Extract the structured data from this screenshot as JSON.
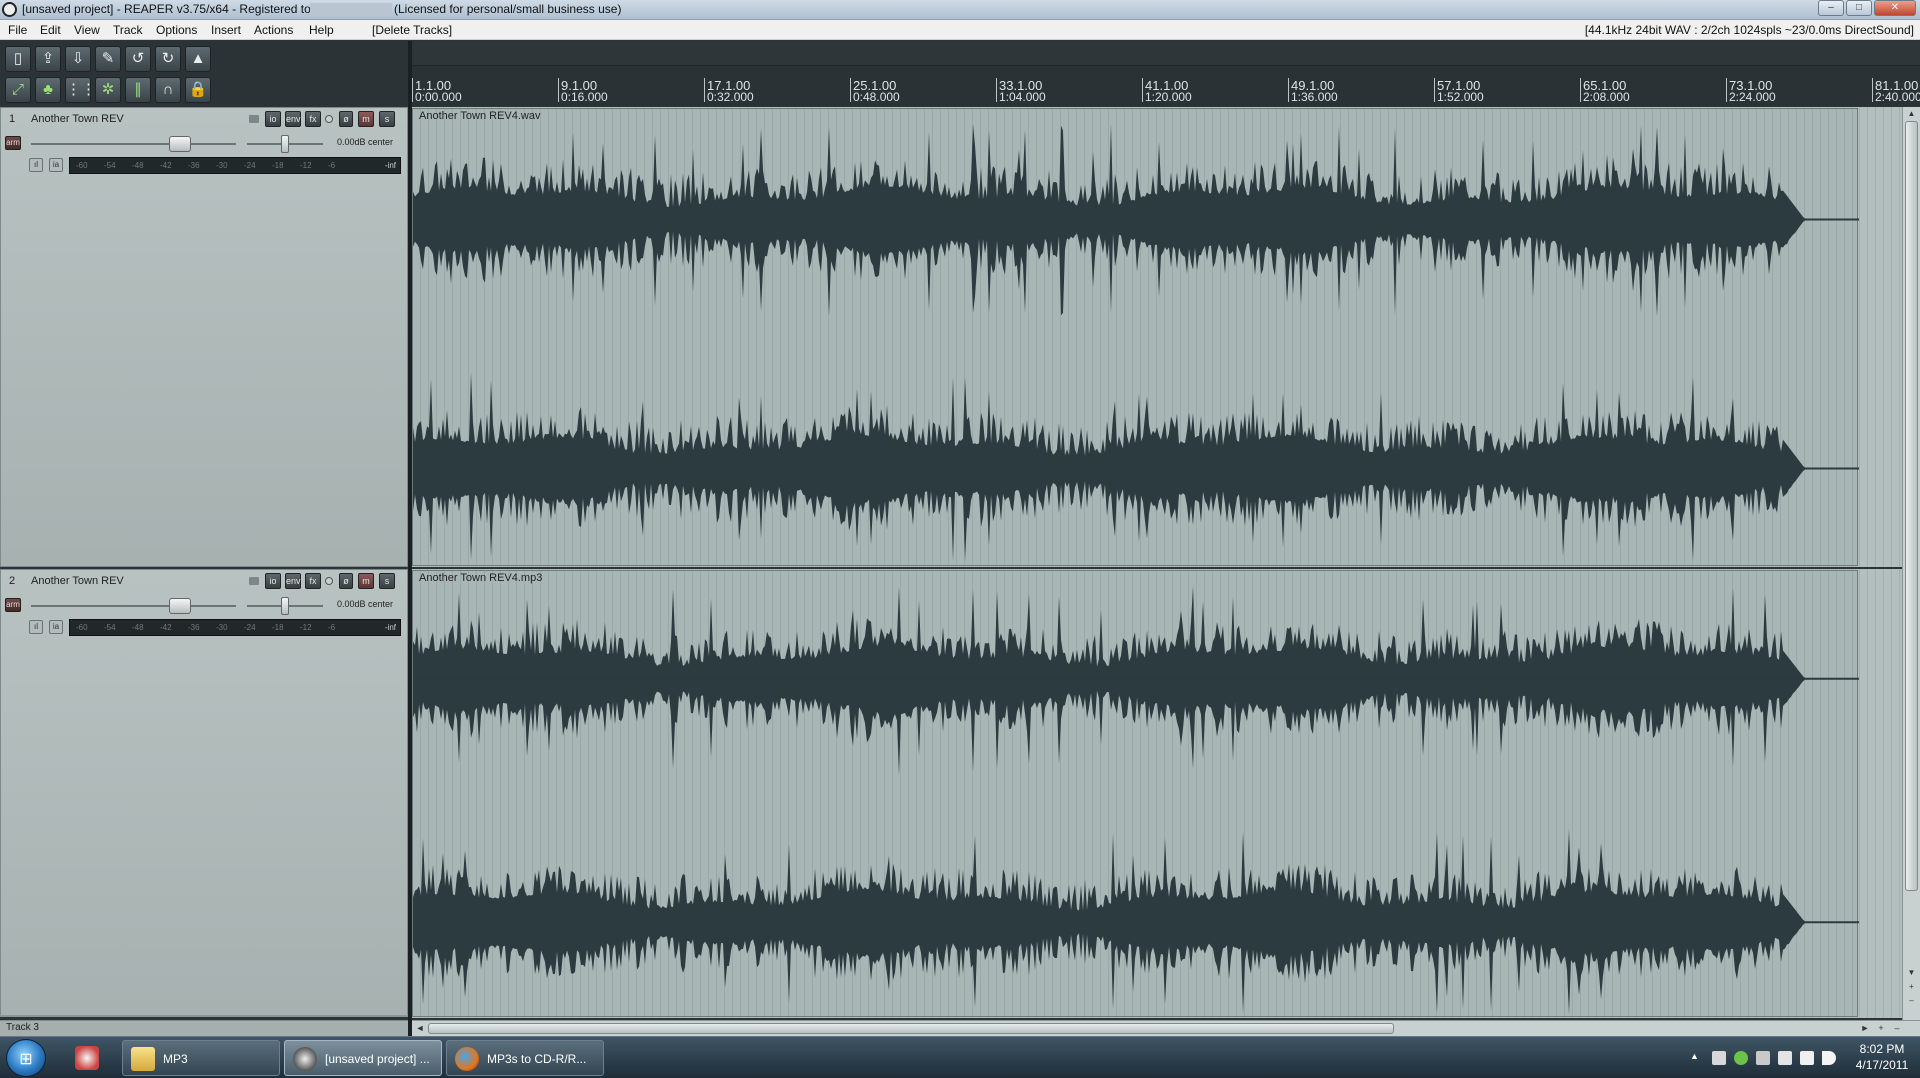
{
  "window": {
    "title": "[unsaved project] - REAPER v3.75/x64 - Registered to",
    "license": "(Licensed for personal/small business use)",
    "minimize": "–",
    "maximize": "□",
    "close": "✕"
  },
  "menu": {
    "items": [
      "File",
      "Edit",
      "View",
      "Track",
      "Options",
      "Insert",
      "Actions",
      "Help",
      "[Delete Tracks]"
    ],
    "status": "[44.1kHz 24bit WAV : 2/2ch 1024spls ~23/0.0ms DirectSound]"
  },
  "toolbar": {
    "row1_icons": [
      "new-project-icon",
      "open-project-icon",
      "save-project-icon",
      "project-settings-icon",
      "undo-icon",
      "redo-icon",
      "metronome-icon"
    ],
    "row2_icons": [
      "auto-crossfade-icon",
      "envelope-lock-icon",
      "grid-icon",
      "snap-icon",
      "ripple-edit-icon",
      "loop-icon",
      "lock-icon"
    ]
  },
  "tracks": [
    {
      "number": "1",
      "name": "Another Town REV",
      "vol_pan": "0.00dB center",
      "meter_scale": [
        "-60",
        "-54",
        "-48",
        "-42",
        "-36",
        "-30",
        "-24",
        "-18",
        "-12",
        "-6"
      ],
      "meter_peak": "-inf",
      "buttons": {
        "io": "io",
        "env": "env",
        "fx": "fx",
        "phase": "ø",
        "mute": "m",
        "solo": "s",
        "arm": "arm",
        "in1": "ıl",
        "in2": "ia"
      },
      "item_name": "Another Town REV4.wav"
    },
    {
      "number": "2",
      "name": "Another Town REV",
      "vol_pan": "0.00dB center",
      "meter_scale": [
        "-60",
        "-54",
        "-48",
        "-42",
        "-36",
        "-30",
        "-24",
        "-18",
        "-12",
        "-6"
      ],
      "meter_peak": "-inf",
      "buttons": {
        "io": "io",
        "env": "env",
        "fx": "fx",
        "phase": "ø",
        "mute": "m",
        "solo": "s",
        "arm": "arm",
        "in1": "ıl",
        "in2": "ia"
      },
      "item_name": "Another Town REV4.mp3"
    }
  ],
  "status_left": "Track 3",
  "ruler": [
    {
      "bar": "1.1.00",
      "time": "0:00.000"
    },
    {
      "bar": "9.1.00",
      "time": "0:16.000"
    },
    {
      "bar": "17.1.00",
      "time": "0:32.000"
    },
    {
      "bar": "25.1.00",
      "time": "0:48.000"
    },
    {
      "bar": "33.1.00",
      "time": "1:04.000"
    },
    {
      "bar": "41.1.00",
      "time": "1:20.000"
    },
    {
      "bar": "49.1.00",
      "time": "1:36.000"
    },
    {
      "bar": "57.1.00",
      "time": "1:52.000"
    },
    {
      "bar": "65.1.00",
      "time": "2:08.000"
    },
    {
      "bar": "73.1.00",
      "time": "2:24.000"
    },
    {
      "bar": "81.1.00",
      "time": "2:40.000"
    }
  ],
  "scroll": {
    "up": "▲",
    "down": "▼",
    "left": "◄",
    "right": "►",
    "zoom_in": "+",
    "zoom_out": "–"
  },
  "taskbar": {
    "start_glyph": "⊞",
    "tasks": [
      {
        "label": "MP3"
      },
      {
        "label": "[unsaved project] ..."
      },
      {
        "label": "MP3s to CD-R/R..."
      }
    ],
    "tray_arrow": "▲",
    "time": "8:02 PM",
    "date": "4/17/2011"
  },
  "colors": {
    "waveform": "#2c3b40",
    "arrange_bg": "#a7b4b4",
    "tcp_bg": "#b3bdbc",
    "taskbar": "#2a3b47"
  }
}
